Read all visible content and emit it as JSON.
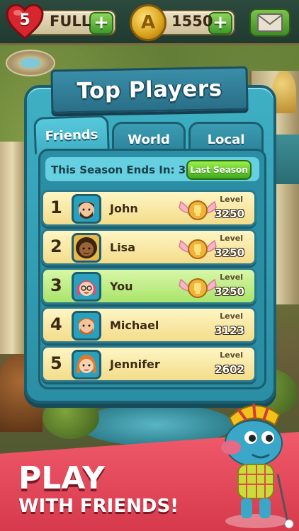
{
  "hud": {
    "lives_count": "5",
    "lives_status": "FULL",
    "coins": "1550",
    "coin_symbol": "A"
  },
  "panel": {
    "title": "Top Players",
    "tabs": [
      {
        "label": "Friends",
        "active": true
      },
      {
        "label": "World",
        "active": false
      },
      {
        "label": "Local",
        "active": false
      }
    ],
    "season_text": "This Season Ends In: 3 days",
    "last_season_label": "Last Season",
    "level_label": "Level",
    "players": [
      {
        "rank": "1",
        "name": "John",
        "level": "3250",
        "trophy": true
      },
      {
        "rank": "2",
        "name": "Lisa",
        "level": "3250",
        "trophy": true
      },
      {
        "rank": "3",
        "name": "You",
        "level": "3250",
        "trophy": true
      },
      {
        "rank": "4",
        "name": "Michael",
        "level": "3123",
        "trophy": false
      },
      {
        "rank": "5",
        "name": "Jennifer",
        "level": "2602",
        "trophy": false
      }
    ]
  },
  "promo": {
    "line1": "PLAY",
    "line2": "WITH FRIENDS!"
  },
  "colors": {
    "panel": "#3fb0c4",
    "row": "#fff6c4",
    "row_highlight": "#a9e46a",
    "promo": "#e04a5a"
  }
}
